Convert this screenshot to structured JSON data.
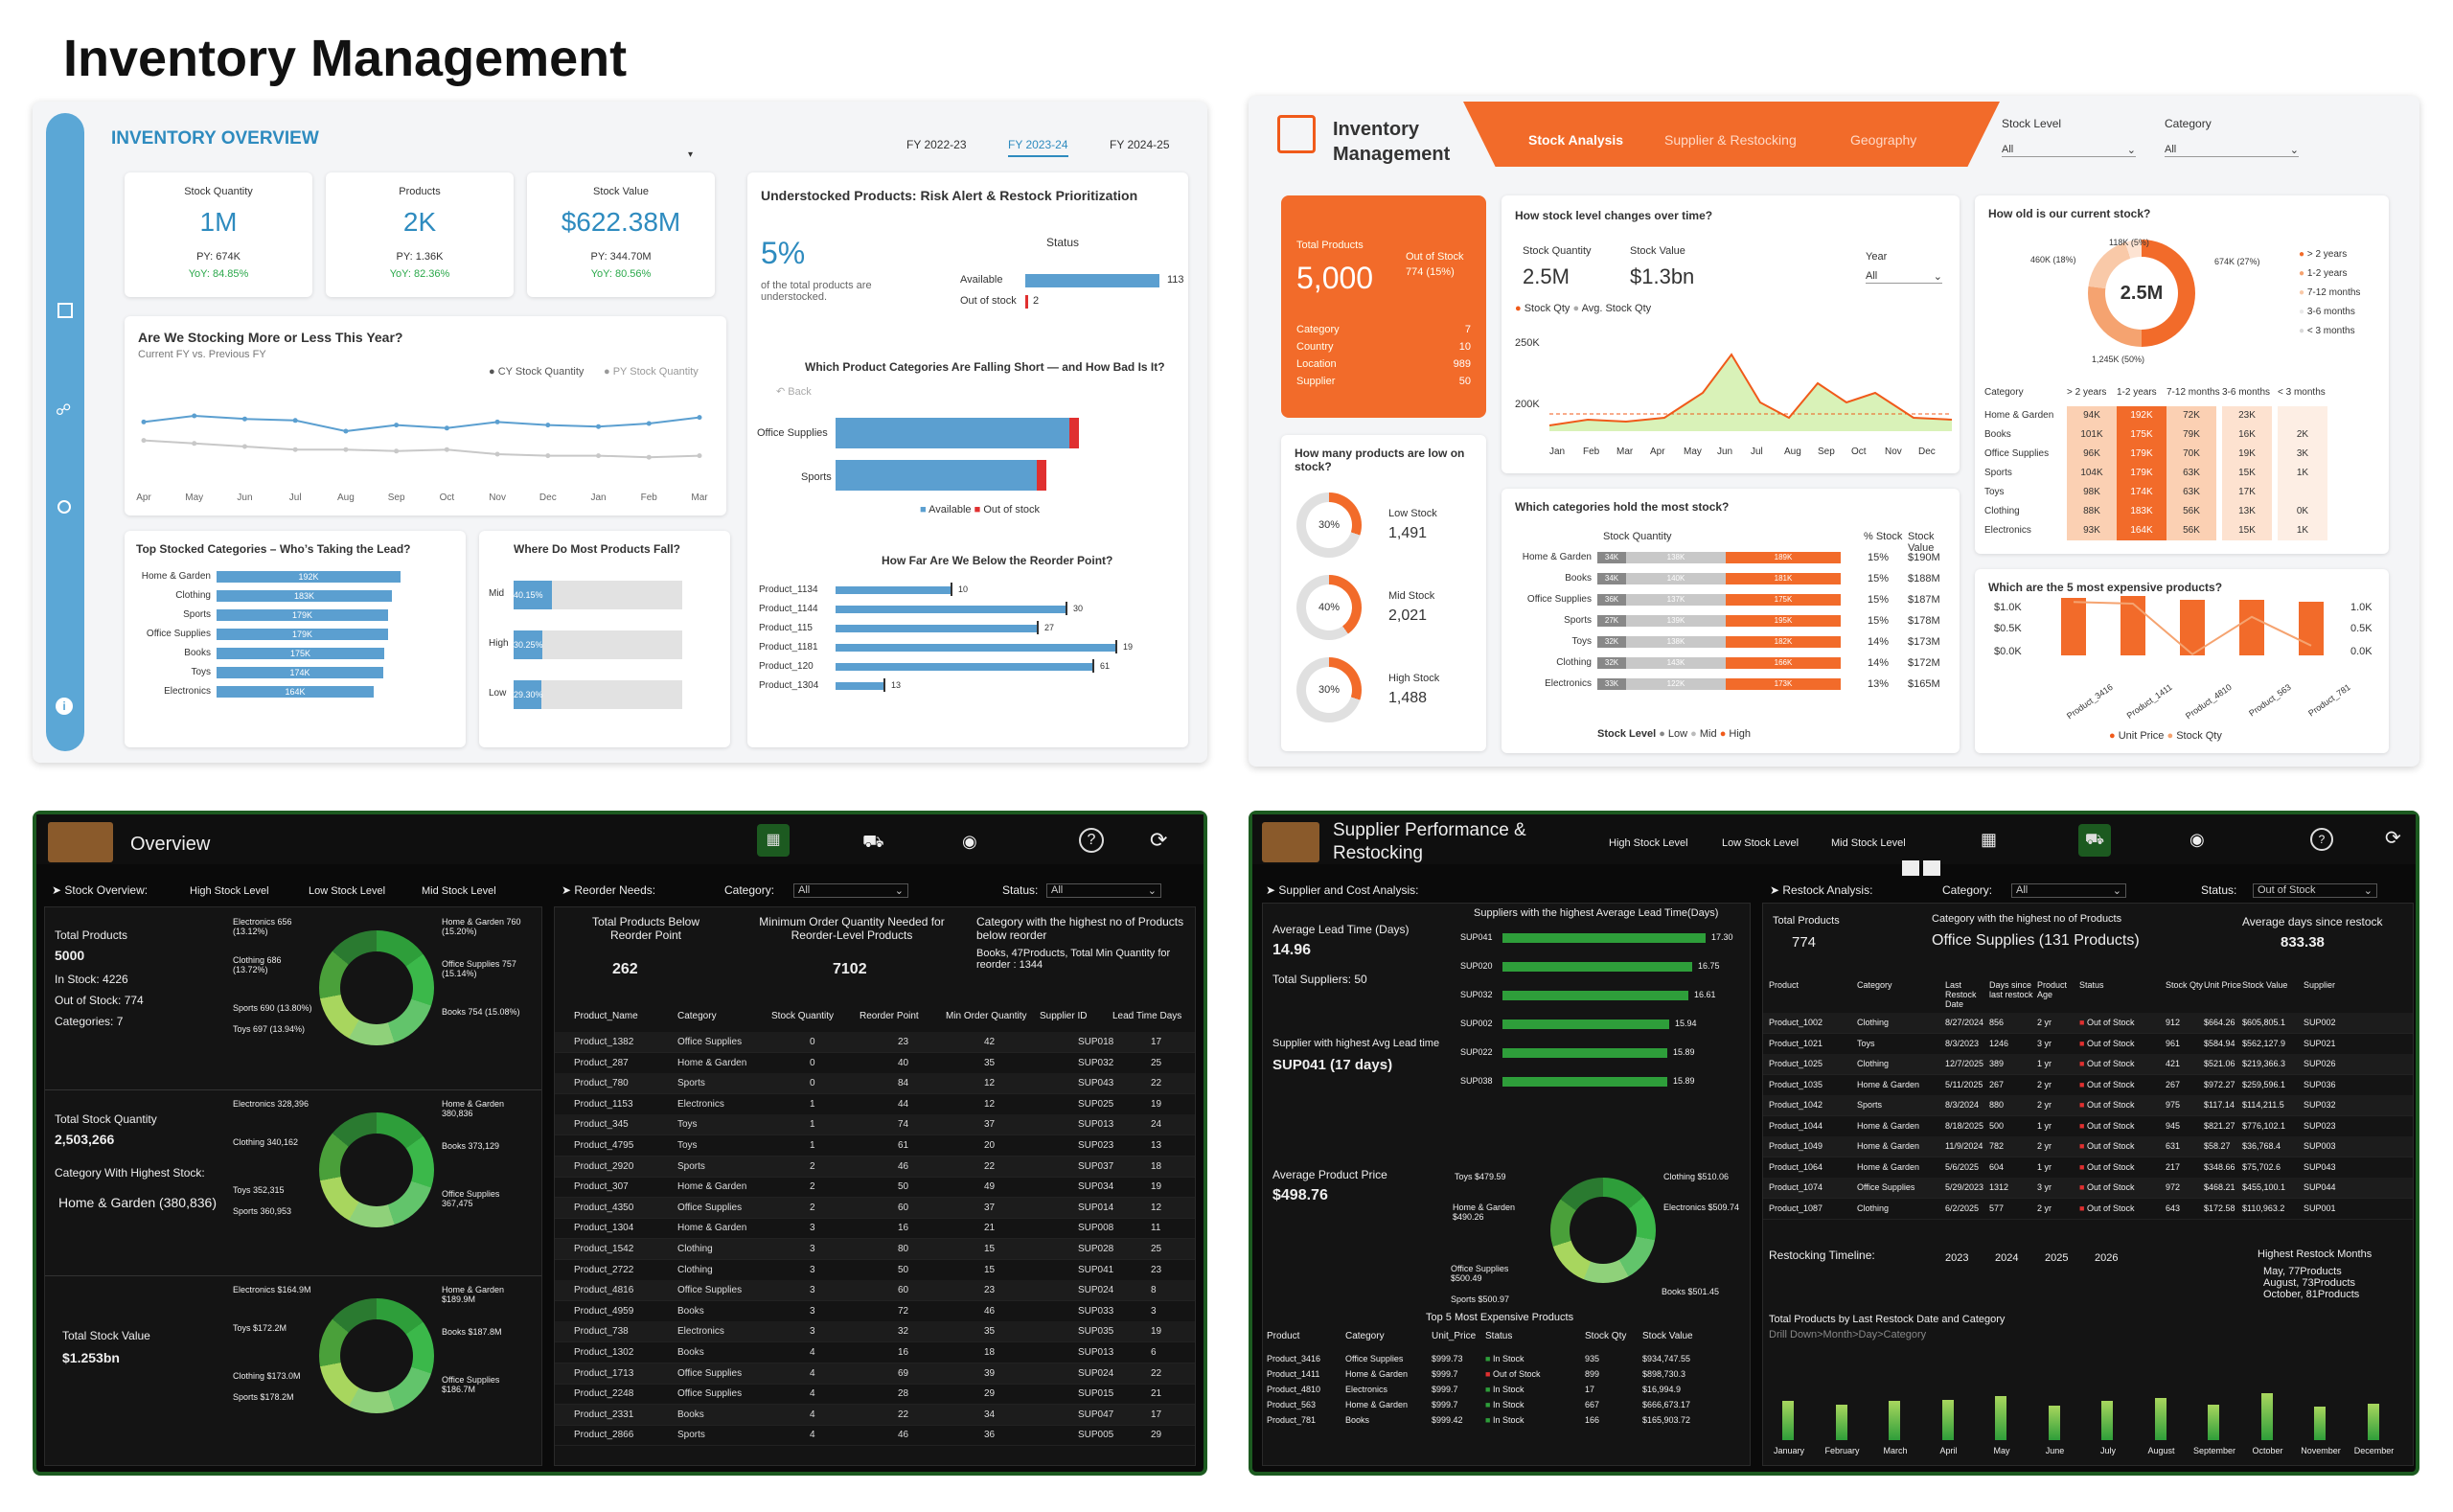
{
  "page_title": "Inventory Management",
  "p1": {
    "header": "INVENTORY OVERVIEW",
    "fy_tabs": [
      "FY 2022-23",
      "FY 2023-24",
      "FY 2024-25"
    ],
    "kpis": [
      {
        "label": "Stock Quantity",
        "value": "1M",
        "py": "PY: 674K",
        "yoy": "YoY: 84.85%"
      },
      {
        "label": "Products",
        "value": "2K",
        "py": "PY: 1.36K",
        "yoy": "YoY: 82.36%"
      },
      {
        "label": "Stock Value",
        "value": "$622.38M",
        "py": "PY: 344.70M",
        "yoy": "YoY: 80.56%"
      }
    ],
    "trend": {
      "title": "Are We Stocking More or Less This Year?",
      "subtitle": "Current FY vs. Previous FY",
      "legend_cy": "CY Stock Quantity",
      "legend_py": "PY Stock Quantity",
      "months": [
        "Apr",
        "May",
        "Jun",
        "Jul",
        "Aug",
        "Sep",
        "Oct",
        "Nov",
        "Dec",
        "Jan",
        "Feb",
        "Mar"
      ],
      "cy": [
        66,
        70,
        68,
        67,
        60,
        64,
        62,
        66,
        64,
        63,
        65,
        69
      ],
      "py": [
        54,
        52,
        50,
        48,
        48,
        47,
        48,
        45,
        44,
        44,
        43,
        44
      ]
    },
    "under": {
      "title": "Understocked Products: Risk Alert & Restock Prioritization",
      "pct": "5%",
      "desc": "of the total products are understocked.",
      "status": "Status",
      "available": "Available",
      "out": "Out of stock",
      "avail_val": "113",
      "out_val": "2"
    },
    "falling": {
      "title": "Which Product Categories Are Falling Short — and How Bad Is It?",
      "back": "Back",
      "cats": [
        "Office Supplies",
        "Sports"
      ],
      "leg_a": "Available",
      "leg_o": "Out of stock"
    },
    "reorder": {
      "title": "How Far Are We Below the Reorder Point?",
      "rows": [
        [
          "Product_1134",
          "10"
        ],
        [
          "Product_1144",
          "30"
        ],
        [
          "Product_115",
          "27"
        ],
        [
          "Product_1181",
          "19"
        ],
        [
          "Product_120",
          "61"
        ],
        [
          "Product_1304",
          "13"
        ]
      ]
    },
    "top": {
      "title": "Top Stocked Categories – Who’s Taking the Lead?",
      "rows": [
        [
          "Home & Garden",
          "192K"
        ],
        [
          "Clothing",
          "183K"
        ],
        [
          "Sports",
          "179K"
        ],
        [
          "Office Supplies",
          "179K"
        ],
        [
          "Books",
          "175K"
        ],
        [
          "Toys",
          "174K"
        ],
        [
          "Electronics",
          "164K"
        ]
      ]
    },
    "fall": {
      "title": "Where Do Most Products Fall?",
      "rows": [
        [
          "Mid",
          "40.15%"
        ],
        [
          "High",
          "30.25%"
        ],
        [
          "Low",
          "29.30%"
        ]
      ]
    }
  },
  "p2": {
    "logo_l1": "Inventory",
    "logo_l2": "Management",
    "tabs": [
      "Stock Analysis",
      "Supplier & Restocking",
      "Geography"
    ],
    "f1": "Stock Level",
    "f2": "Category",
    "all": "All",
    "total": {
      "label": "Total Products",
      "value": "5,000",
      "oos_label": "Out of Stock",
      "oos": "774 (15%)",
      "rows": [
        [
          "Category",
          "7"
        ],
        [
          "Country",
          "10"
        ],
        [
          "Location",
          "989"
        ],
        [
          "Supplier",
          "50"
        ]
      ]
    },
    "low_title": "How many products are low on stock?",
    "levels": [
      [
        "30%",
        "Low Stock",
        "1,491"
      ],
      [
        "40%",
        "Mid Stock",
        "2,021"
      ],
      [
        "30%",
        "High Stock",
        "1,488"
      ]
    ],
    "changes": {
      "title": "How stock level changes over time?",
      "q_label": "Stock Quantity",
      "q": "2.5M",
      "v_label": "Stock Value",
      "v": "$1.3bn",
      "year": "Year",
      "leg1": "Stock Qty",
      "leg2": "Avg. Stock Qty",
      "y1": "250K",
      "y2": "200K",
      "months": [
        "Jan",
        "Feb",
        "Mar",
        "Apr",
        "May",
        "Jun",
        "Jul",
        "Aug",
        "Sep",
        "Oct",
        "Nov",
        "Dec"
      ]
    },
    "cat": {
      "title": "Which categories hold the most stock?",
      "h1": "Stock Quantity",
      "h2": "% Stock",
      "h3": "Stock Value",
      "rows": [
        [
          "Home & Garden",
          "34K",
          "138K",
          "189K",
          "15%",
          "$190M"
        ],
        [
          "Books",
          "34K",
          "140K",
          "181K",
          "15%",
          "$188M"
        ],
        [
          "Office Supplies",
          "36K",
          "137K",
          "175K",
          "15%",
          "$187M"
        ],
        [
          "Sports",
          "27K",
          "139K",
          "195K",
          "15%",
          "$178M"
        ],
        [
          "Toys",
          "32K",
          "138K",
          "182K",
          "14%",
          "$173M"
        ],
        [
          "Clothing",
          "32K",
          "143K",
          "166K",
          "14%",
          "$172M"
        ],
        [
          "Electronics",
          "33K",
          "122K",
          "173K",
          "13%",
          "$165M"
        ]
      ],
      "leg": "Stock Level",
      "leg_l": "Low",
      "leg_m": "Mid",
      "leg_h": "High"
    },
    "age": {
      "title": "How old is our current stock?",
      "center": "2.5M",
      "labels": [
        "118K (5%)",
        "460K (18%)",
        "674K (27%)",
        "1,245K (50%)"
      ],
      "legend": [
        "> 2 years",
        "1-2 years",
        "7-12 months",
        "3-6 months",
        "< 3 months"
      ],
      "cols": [
        "Category",
        "> 2 years",
        "1-2 years",
        "7-12 months",
        "3-6 months",
        "< 3 months"
      ],
      "rows": [
        [
          "Home & Garden",
          "94K",
          "192K",
          "72K",
          "23K",
          ""
        ],
        [
          "Books",
          "101K",
          "175K",
          "79K",
          "16K",
          "2K"
        ],
        [
          "Office Supplies",
          "96K",
          "179K",
          "70K",
          "19K",
          "3K"
        ],
        [
          "Sports",
          "104K",
          "179K",
          "63K",
          "15K",
          "1K"
        ],
        [
          "Toys",
          "98K",
          "174K",
          "63K",
          "17K",
          ""
        ],
        [
          "Clothing",
          "88K",
          "183K",
          "56K",
          "13K",
          "0K"
        ],
        [
          "Electronics",
          "93K",
          "164K",
          "56K",
          "15K",
          "1K"
        ]
      ]
    },
    "exp": {
      "title": "Which are the 5 most expensive products?",
      "y_l": [
        "$1.0K",
        "$0.5K",
        "$0.0K"
      ],
      "y_r": [
        "1.0K",
        "0.5K",
        "0.0K"
      ],
      "yl": "Unit Price",
      "yr": "Stock Qty",
      "products": [
        "Product_3416",
        "Product_1411",
        "Product_4810",
        "Product_563",
        "Product_781"
      ],
      "leg1": "Unit Price",
      "leg2": "Stock Qty"
    }
  },
  "p3": {
    "title": "Overview",
    "tabs": [
      "Stock Overview:",
      "High Stock Level",
      "Low Stock Level",
      "Mid Stock Level"
    ],
    "filters": {
      "reorder": "Reorder Needs:",
      "cat": "Category:",
      "status": "Status:",
      "all": "All"
    },
    "summary": [
      "Total Products",
      "5000",
      "In Stock: 4226",
      "Out of Stock: 774",
      "Categories: 7"
    ],
    "qty": [
      "Total Stock Quantity",
      "2,503,266",
      "Category With Highest Stock:",
      "Home & Garden (380,836)"
    ],
    "val": [
      "Total Stock Value",
      "$1.253bn"
    ],
    "d1": [
      "Electronics 656 (13.12%)",
      "Clothing 686 (13.72%)",
      "Sports 690 (13.80%)",
      "Toys 697 (13.94%)",
      "Home & Garden 760 (15.20%)",
      "Office Supplies 757 (15.14%)",
      "Books 754 (15.08%)"
    ],
    "d2": [
      "Electronics 328,396",
      "Clothing 340,162",
      "Toys 352,315",
      "Sports 360,953",
      "Home & Garden 380,836",
      "Books 373,129",
      "Office Supplies 367,475"
    ],
    "d3": [
      "Electronics $164.9M",
      "Toys $172.2M",
      "Clothing $173.0M",
      "Sports $178.2M",
      "Home & Garden $189.9M",
      "Books $187.8M",
      "Office Supplies $186.7M"
    ],
    "k1": [
      "Total Products Below Reorder Point",
      "262"
    ],
    "k2": [
      "Minimum Order Quantity Needed for Reorder-Level Products",
      "7102"
    ],
    "k3": [
      "Category with the highest no of Products below reorder",
      "Books, 47Products, Total Min Quantity for reorder : 1344"
    ],
    "cols": [
      "Product_Name",
      "Category",
      "Stock Quantity",
      "Reorder Point",
      "Min Order Quantity",
      "Supplier ID",
      "Lead Time Days"
    ],
    "rows": [
      [
        "Product_1382",
        "Office Supplies",
        "0",
        "23",
        "42",
        "SUP018",
        "17"
      ],
      [
        "Product_287",
        "Home & Garden",
        "0",
        "40",
        "35",
        "SUP032",
        "25"
      ],
      [
        "Product_780",
        "Sports",
        "0",
        "84",
        "12",
        "SUP043",
        "22"
      ],
      [
        "Product_1153",
        "Electronics",
        "1",
        "44",
        "12",
        "SUP025",
        "19"
      ],
      [
        "Product_345",
        "Toys",
        "1",
        "74",
        "37",
        "SUP013",
        "24"
      ],
      [
        "Product_4795",
        "Toys",
        "1",
        "61",
        "20",
        "SUP023",
        "13"
      ],
      [
        "Product_2920",
        "Sports",
        "2",
        "46",
        "22",
        "SUP037",
        "18"
      ],
      [
        "Product_307",
        "Home & Garden",
        "2",
        "50",
        "49",
        "SUP034",
        "19"
      ],
      [
        "Product_4350",
        "Office Supplies",
        "2",
        "60",
        "37",
        "SUP014",
        "12"
      ],
      [
        "Product_1304",
        "Home & Garden",
        "3",
        "16",
        "21",
        "SUP008",
        "11"
      ],
      [
        "Product_1542",
        "Clothing",
        "3",
        "80",
        "15",
        "SUP028",
        "25"
      ],
      [
        "Product_2722",
        "Clothing",
        "3",
        "50",
        "15",
        "SUP041",
        "23"
      ],
      [
        "Product_4816",
        "Office Supplies",
        "3",
        "60",
        "23",
        "SUP024",
        "8"
      ],
      [
        "Product_4959",
        "Books",
        "3",
        "72",
        "46",
        "SUP033",
        "3"
      ],
      [
        "Product_738",
        "Electronics",
        "3",
        "32",
        "35",
        "SUP035",
        "19"
      ],
      [
        "Product_1302",
        "Books",
        "4",
        "16",
        "18",
        "SUP013",
        "6"
      ],
      [
        "Product_1713",
        "Office Supplies",
        "4",
        "69",
        "39",
        "SUP024",
        "22"
      ],
      [
        "Product_2248",
        "Office Supplies",
        "4",
        "28",
        "29",
        "SUP015",
        "21"
      ],
      [
        "Product_2331",
        "Books",
        "4",
        "22",
        "34",
        "SUP047",
        "17"
      ],
      [
        "Product_2866",
        "Sports",
        "4",
        "46",
        "36",
        "SUP005",
        "29"
      ]
    ]
  },
  "p4": {
    "title1": "Supplier Performance &",
    "title2": "Restocking",
    "tabs": [
      "High Stock Level",
      "Low Stock Level",
      "Mid Stock Level"
    ],
    "sc": "Supplier and Cost Analysis:",
    "lead": [
      "Average Lead Time (Days)",
      "14.96",
      "Total Suppliers: 50"
    ],
    "hl": [
      "Supplier with highest Avg Lead time",
      "SUP041 (17 days)"
    ],
    "sup_title": "Suppliers with the highest Average Lead Time(Days)",
    "sups": [
      [
        "SUP041",
        "17.30"
      ],
      [
        "SUP020",
        "16.75"
      ],
      [
        "SUP032",
        "16.61"
      ],
      [
        "SUP002",
        "15.94"
      ],
      [
        "SUP022",
        "15.89"
      ],
      [
        "SUP038",
        "15.89"
      ]
    ],
    "price": [
      "Average Product Price",
      "$498.76"
    ],
    "donut": [
      "Toys $479.59",
      "Home & Garden $490.26",
      "Office Supplies $500.49",
      "Sports $500.97",
      "Clothing $510.06",
      "Electronics $509.74",
      "Books $501.45"
    ],
    "top5": {
      "title": "Top 5 Most Expensive Products",
      "cols": [
        "Product",
        "Category",
        "Unit_Price",
        "Status",
        "Stock Qty",
        "Stock Value"
      ],
      "rows": [
        [
          "Product_3416",
          "Office Supplies",
          "$999.73",
          "In Stock",
          "935",
          "$934,747.55"
        ],
        [
          "Product_1411",
          "Home & Garden",
          "$999.7",
          "Out of Stock",
          "899",
          "$898,730.3"
        ],
        [
          "Product_4810",
          "Electronics",
          "$999.7",
          "In Stock",
          "17",
          "$16,994.9"
        ],
        [
          "Product_563",
          "Home & Garden",
          "$999.7",
          "In Stock",
          "667",
          "$666,673.17"
        ],
        [
          "Product_781",
          "Books",
          "$999.42",
          "In Stock",
          "166",
          "$165,903.72"
        ]
      ]
    },
    "ra": {
      "title": "Restock Analysis:",
      "cat": "Category:",
      "status": "Status:",
      "all": "All",
      "oos": "Out of Stock"
    },
    "k1": [
      "Total Products",
      "774"
    ],
    "k2": [
      "Category with the highest no of Products",
      "Office Supplies (131 Products)"
    ],
    "k3": [
      "Average days since restock",
      "833.38"
    ],
    "cols": [
      "Product",
      "Category",
      "Last Restock Date",
      "Days since last restock",
      "Product Age",
      "Status",
      "Stock Qty",
      "Unit Price",
      "Stock Value",
      "Supplier"
    ],
    "rows": [
      [
        "Product_1002",
        "Clothing",
        "8/27/2024",
        "856",
        "2 yr",
        "Out of Stock",
        "912",
        "$664.26",
        "$605,805.1",
        "SUP002"
      ],
      [
        "Product_1021",
        "Toys",
        "8/3/2023",
        "1246",
        "3 yr",
        "Out of Stock",
        "961",
        "$584.94",
        "$562,127.9",
        "SUP021"
      ],
      [
        "Product_1025",
        "Clothing",
        "12/7/2025",
        "389",
        "1 yr",
        "Out of Stock",
        "421",
        "$521.06",
        "$219,366.3",
        "SUP026"
      ],
      [
        "Product_1035",
        "Home & Garden",
        "5/11/2025",
        "267",
        "2 yr",
        "Out of Stock",
        "267",
        "$972.27",
        "$259,596.1",
        "SUP036"
      ],
      [
        "Product_1042",
        "Sports",
        "8/3/2024",
        "880",
        "2 yr",
        "Out of Stock",
        "975",
        "$117.14",
        "$114,211.5",
        "SUP032"
      ],
      [
        "Product_1044",
        "Home & Garden",
        "8/18/2025",
        "500",
        "1 yr",
        "Out of Stock",
        "945",
        "$821.27",
        "$776,102.1",
        "SUP023"
      ],
      [
        "Product_1049",
        "Home & Garden",
        "11/9/2024",
        "782",
        "2 yr",
        "Out of Stock",
        "631",
        "$58.27",
        "$36,768.4",
        "SUP003"
      ],
      [
        "Product_1064",
        "Home & Garden",
        "5/6/2025",
        "604",
        "1 yr",
        "Out of Stock",
        "217",
        "$348.66",
        "$75,702.6",
        "SUP043"
      ],
      [
        "Product_1074",
        "Office Supplies",
        "5/29/2023",
        "1312",
        "3 yr",
        "Out of Stock",
        "972",
        "$468.21",
        "$455,100.1",
        "SUP044"
      ],
      [
        "Product_1087",
        "Clothing",
        "6/2/2025",
        "577",
        "2 yr",
        "Out of Stock",
        "643",
        "$172.58",
        "$110,963.2",
        "SUP001"
      ]
    ],
    "tl": {
      "title": "Restocking Timeline:",
      "years": [
        "2023",
        "2024",
        "2025",
        "2026"
      ],
      "high_t": "Highest Restock Months",
      "high": [
        "May, 77Products",
        "August, 73Products",
        "October, 81Products"
      ],
      "chart_t": "Total Products by Last Restock Date and Category",
      "drill": "Drill Down>Month>Day>Category",
      "months": [
        "January",
        "February",
        "March",
        "April",
        "May",
        "June",
        "July",
        "August",
        "September",
        "October",
        "November",
        "December"
      ],
      "values": [
        68,
        62,
        69,
        70,
        77,
        60,
        68,
        73,
        62,
        81,
        58,
        64
      ]
    }
  }
}
